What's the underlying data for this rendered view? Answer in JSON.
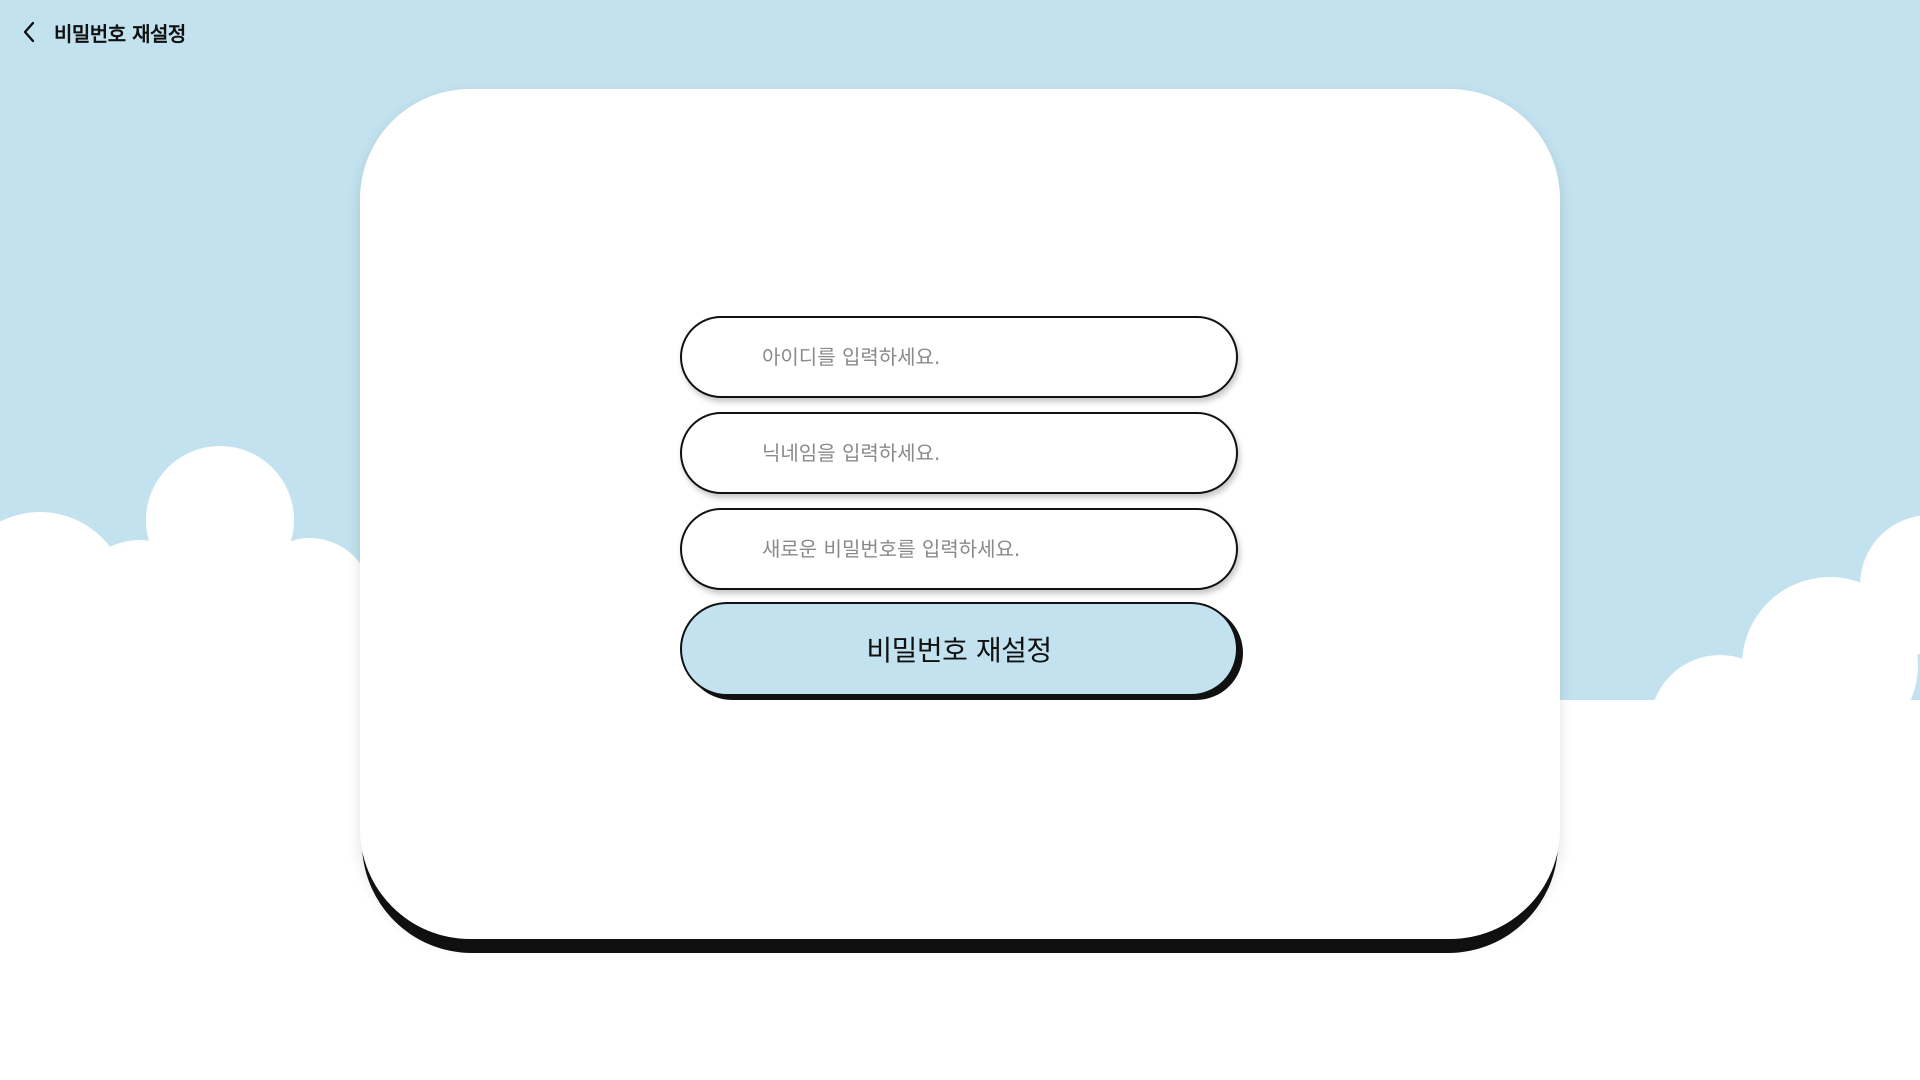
{
  "header": {
    "back_icon": "chevron-left-icon",
    "title": "비밀번호 재설정"
  },
  "form": {
    "id_placeholder": "아이디를 입력하세요.",
    "nickname_placeholder": "닉네임을 입력하세요.",
    "new_password_placeholder": "새로운 비밀번호를 입력하세요.",
    "submit_label": "비밀번호 재설정"
  },
  "colors": {
    "sky": "#c2e2ef",
    "card": "#ffffff",
    "outline": "#111111"
  }
}
